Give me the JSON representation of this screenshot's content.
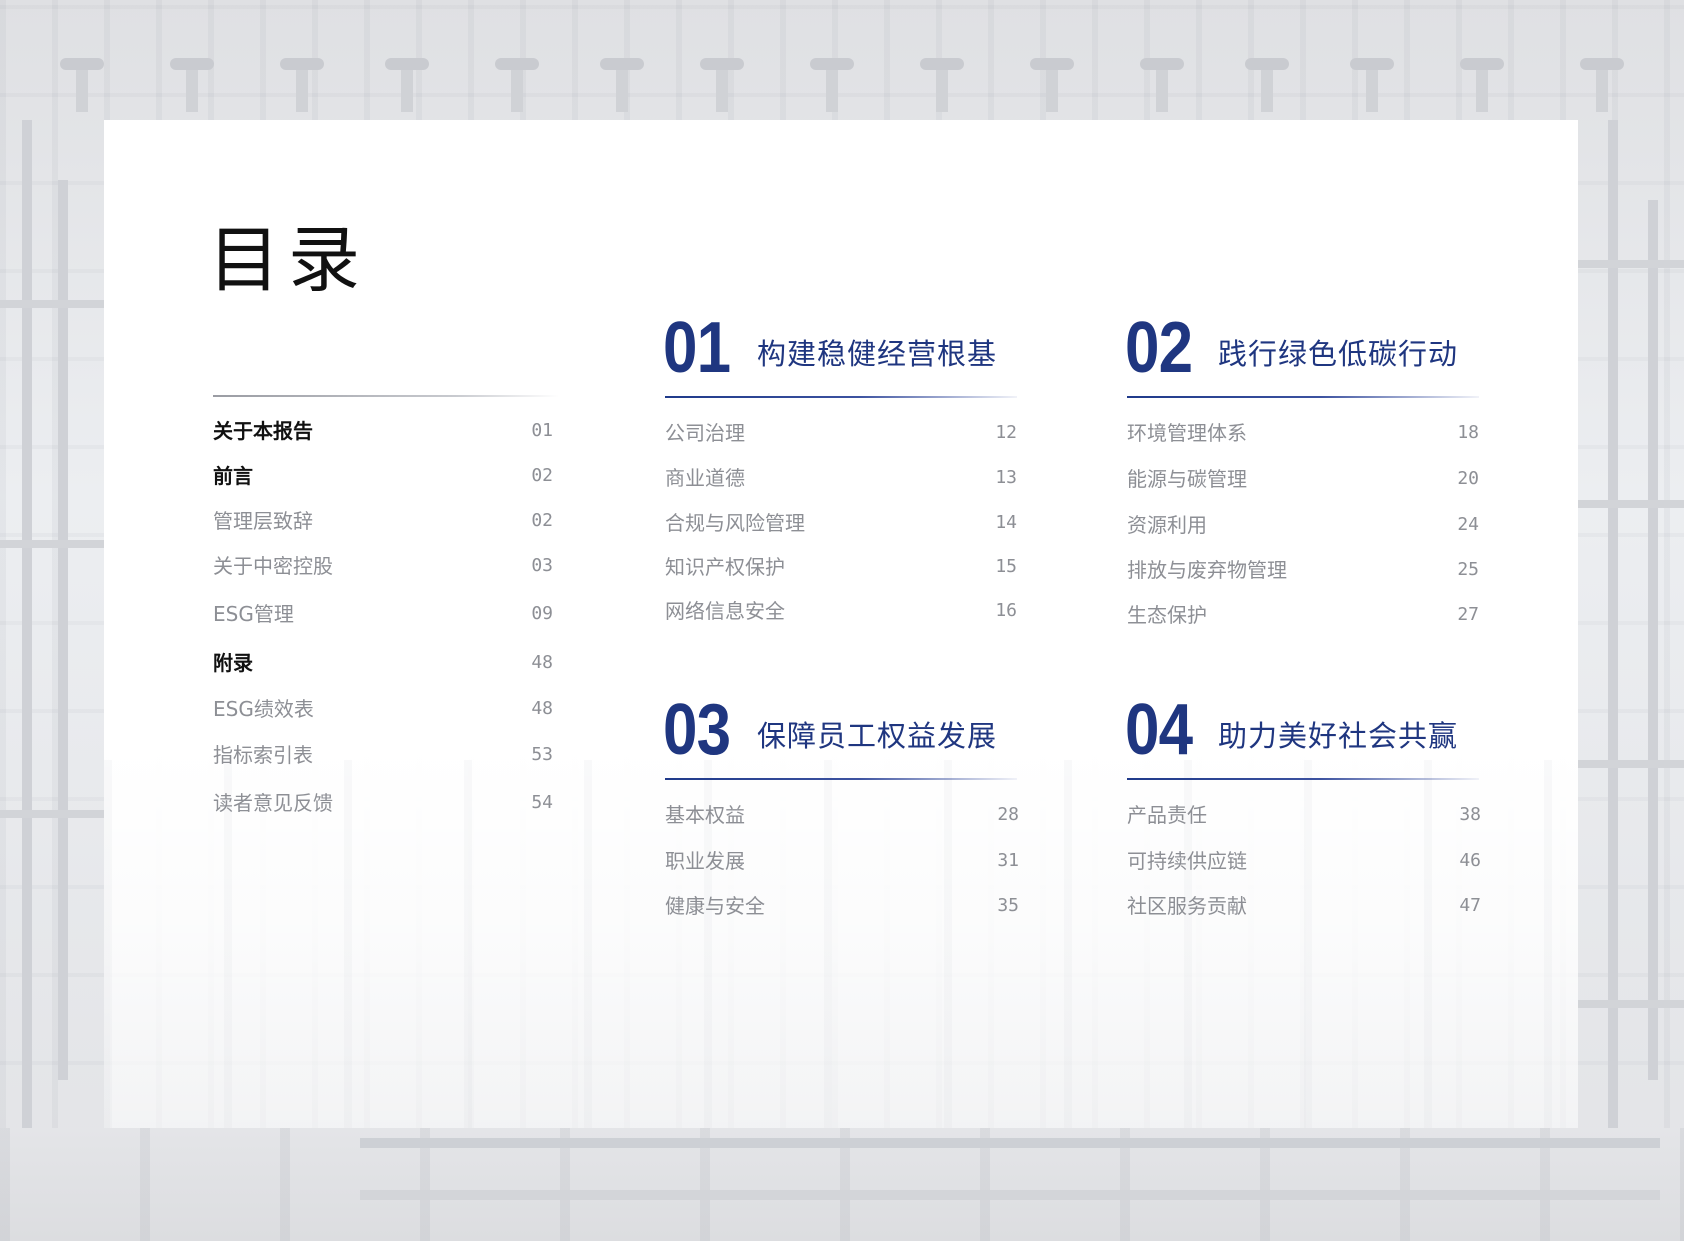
{
  "title": "目录",
  "left_column": [
    {
      "label": "关于本报告",
      "page": "01",
      "bold": true
    },
    {
      "label": "前言",
      "page": "02",
      "bold": true
    },
    {
      "label": "管理层致辞",
      "page": "02",
      "bold": false
    },
    {
      "label": "关于中密控股",
      "page": "03",
      "bold": false
    },
    {
      "label": "ESG管理",
      "page": "09",
      "bold": false
    },
    {
      "label": "附录",
      "page": "48",
      "bold": true
    },
    {
      "label": "ESG绩效表",
      "page": "48",
      "bold": false
    },
    {
      "label": "指标索引表",
      "page": "53",
      "bold": false
    },
    {
      "label": "读者意见反馈",
      "page": "54",
      "bold": false
    }
  ],
  "sections": [
    {
      "number": "01",
      "title": "构建稳健经营根基",
      "items": [
        {
          "label": "公司治理",
          "page": "12"
        },
        {
          "label": "商业道德",
          "page": "13"
        },
        {
          "label": "合规与风险管理",
          "page": "14"
        },
        {
          "label": "知识产权保护",
          "page": "15"
        },
        {
          "label": "网络信息安全",
          "page": "16"
        }
      ]
    },
    {
      "number": "02",
      "title": "践行绿色低碳行动",
      "items": [
        {
          "label": "环境管理体系",
          "page": "18"
        },
        {
          "label": "能源与碳管理",
          "page": "20"
        },
        {
          "label": "资源利用",
          "page": "24"
        },
        {
          "label": "排放与废弃物管理",
          "page": "25"
        },
        {
          "label": "生态保护",
          "page": "27"
        }
      ]
    },
    {
      "number": "03",
      "title": "保障员工权益发展",
      "items": [
        {
          "label": "基本权益",
          "page": "28"
        },
        {
          "label": "职业发展",
          "page": "31"
        },
        {
          "label": "健康与安全",
          "page": "35"
        }
      ]
    },
    {
      "number": "04",
      "title": "助力美好社会共赢",
      "items": [
        {
          "label": "产品责任",
          "page": "38"
        },
        {
          "label": "可持续供应链",
          "page": "46"
        },
        {
          "label": "社区服务贡献",
          "page": "47"
        }
      ]
    }
  ],
  "colors": {
    "accent": "#1f3680",
    "muted_text": "#8d8f95",
    "heading_text": "#111111"
  }
}
